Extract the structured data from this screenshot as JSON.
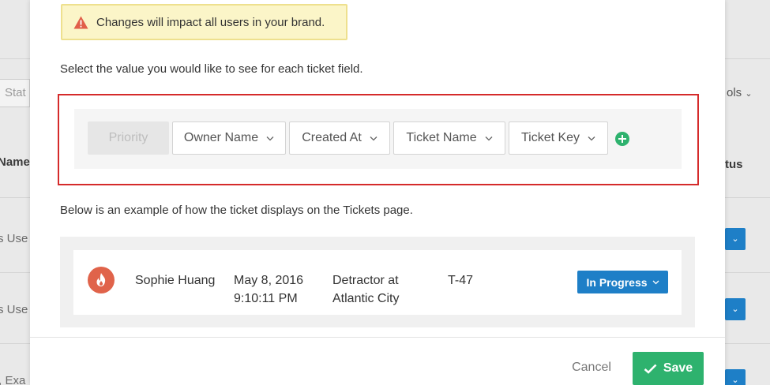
{
  "background": {
    "left_fragments": [
      "Stat",
      "Name",
      "s Use",
      "s Use",
      "r, Exa"
    ],
    "right_fragments": [
      "ols",
      "tus"
    ]
  },
  "modal": {
    "warning_text": "Changes will impact all users in your brand.",
    "select_instruction": "Select the value you would like to see for each ticket field.",
    "fields": [
      {
        "label": "Priority",
        "disabled": true
      },
      {
        "label": "Owner Name",
        "disabled": false
      },
      {
        "label": "Created At",
        "disabled": false
      },
      {
        "label": "Ticket Name",
        "disabled": false
      },
      {
        "label": "Ticket Key",
        "disabled": false
      }
    ],
    "example_instruction": "Below is an example of how the ticket displays on the Tickets page.",
    "example": {
      "owner": "Sophie Huang",
      "date": "May 8, 2016",
      "time": "9:10:11 PM",
      "ticket_name_line1": "Detractor at",
      "ticket_name_line2": "Atlantic City",
      "ticket_key": "T-47",
      "status": "In Progress"
    },
    "cancel_label": "Cancel",
    "save_label": "Save"
  },
  "colors": {
    "accent_blue": "#1e7fc7",
    "save_green": "#2eb26e",
    "highlight_red": "#d52b2b",
    "warning_bg": "#fbf5c8",
    "fire_icon": "#e0634a"
  }
}
